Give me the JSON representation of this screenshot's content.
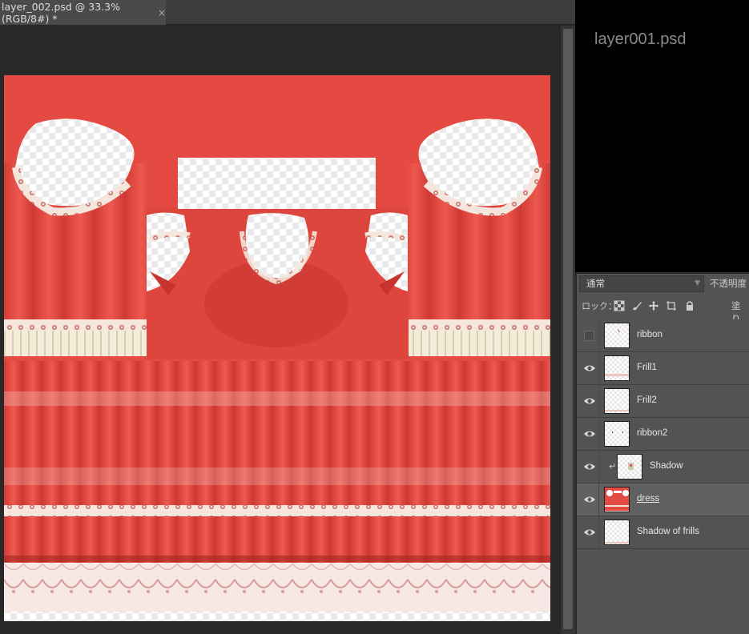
{
  "document_tab": {
    "title": "layer_002.psd @ 33.3% (RGB/8#) *",
    "close": "×"
  },
  "preview": {
    "title": "layer001.psd"
  },
  "layers_panel": {
    "blend_mode": "通常",
    "opacity_label": "不透明度",
    "lock_label": "ロック：",
    "fill_label": "塗り",
    "layers": [
      {
        "name": "ribbon",
        "visible": false
      },
      {
        "name": "Frill1",
        "visible": true
      },
      {
        "name": "Frill2",
        "visible": true
      },
      {
        "name": "ribbon2",
        "visible": true
      },
      {
        "name": "Shadow",
        "visible": true,
        "clipped": true
      },
      {
        "name": "dress",
        "visible": true,
        "selected": true
      },
      {
        "name": "Shadow of frills",
        "visible": true
      }
    ]
  },
  "colors": {
    "dress_red": "#e44a42",
    "panel_bg": "#535353",
    "workspace": "#282828"
  }
}
